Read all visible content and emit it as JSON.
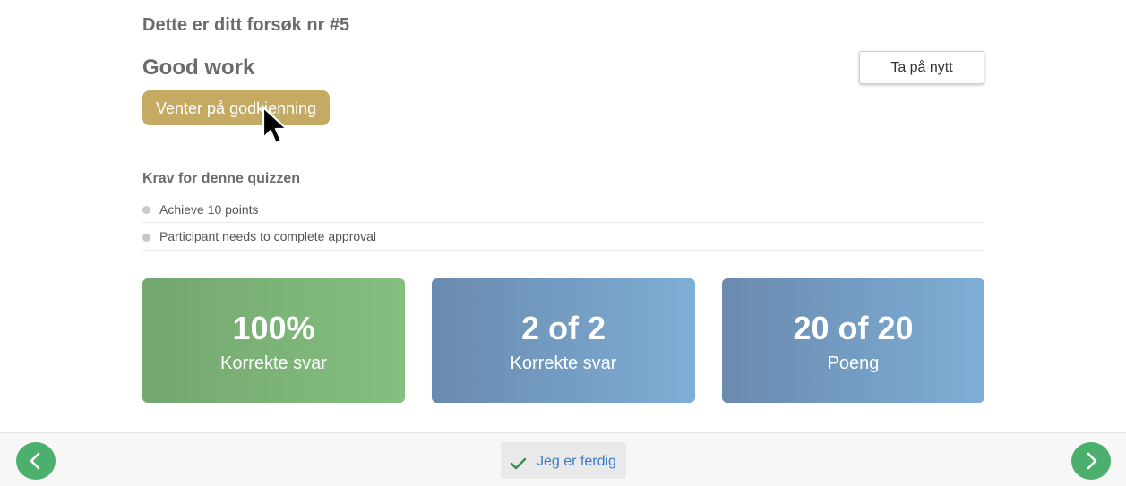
{
  "attempt": {
    "title": "Dette er ditt forsøk nr #5"
  },
  "result": {
    "title": "Good work",
    "retry_label": "Ta på nytt",
    "status_badge": "Venter på godkjenning"
  },
  "requirements": {
    "heading": "Krav for denne quizzen",
    "items": [
      {
        "label": "Achieve 10 points"
      },
      {
        "label": "Participant needs to complete approval"
      }
    ]
  },
  "stats": [
    {
      "value": "100%",
      "label": "Korrekte svar",
      "color": "#7ab475"
    },
    {
      "value": "2 of 2",
      "label": "Korrekte svar",
      "color": "#749cc2"
    },
    {
      "value": "20 of 20",
      "label": "Poeng",
      "color": "#749cc2"
    }
  ],
  "footer": {
    "done_label": "Jeg er ferdig",
    "prev_icon": "chevron-left-icon",
    "next_icon": "chevron-right-icon",
    "done_icon": "checkmark-icon",
    "nav_color": "#4caf6e",
    "done_text_color": "#3c7ac7"
  },
  "colors": {
    "badge": "#c4aa62",
    "text": "#6b6b6b"
  }
}
